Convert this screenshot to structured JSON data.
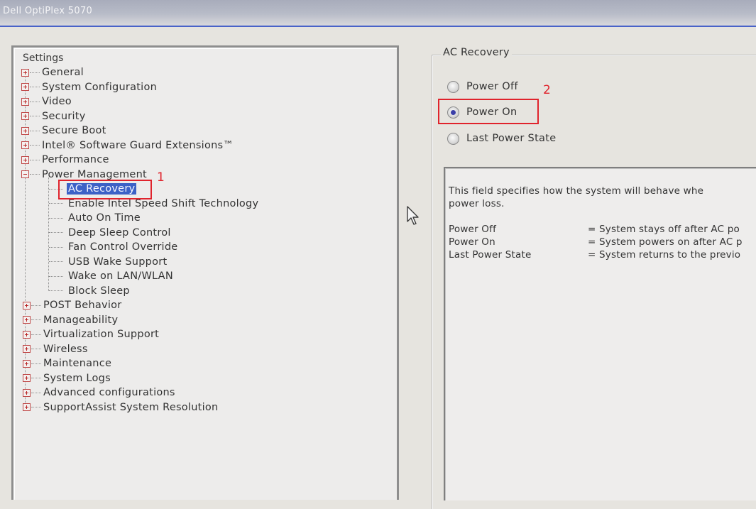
{
  "window": {
    "title": "Dell OptiPlex 5070"
  },
  "tree": {
    "root_label": "Settings",
    "categories_top": [
      {
        "label": "General",
        "expanded": false
      },
      {
        "label": "System Configuration",
        "expanded": false
      },
      {
        "label": "Video",
        "expanded": false
      },
      {
        "label": "Security",
        "expanded": false
      },
      {
        "label": "Secure Boot",
        "expanded": false
      },
      {
        "label": "Intel® Software Guard Extensions™",
        "expanded": false
      },
      {
        "label": "Performance",
        "expanded": false
      },
      {
        "label": "Power Management",
        "expanded": true
      }
    ],
    "power_management_children": [
      {
        "label": "AC Recovery",
        "selected": true
      },
      {
        "label": "Enable Intel Speed Shift Technology",
        "selected": false
      },
      {
        "label": "Auto On Time",
        "selected": false
      },
      {
        "label": "Deep Sleep Control",
        "selected": false
      },
      {
        "label": "Fan Control Override",
        "selected": false
      },
      {
        "label": "USB Wake Support",
        "selected": false
      },
      {
        "label": "Wake on LAN/WLAN",
        "selected": false
      },
      {
        "label": "Block Sleep",
        "selected": false
      }
    ],
    "categories_bottom": [
      {
        "label": "POST Behavior",
        "expanded": false
      },
      {
        "label": "Manageability",
        "expanded": false
      },
      {
        "label": "Virtualization Support",
        "expanded": false
      },
      {
        "label": "Wireless",
        "expanded": false
      },
      {
        "label": "Maintenance",
        "expanded": false
      },
      {
        "label": "System Logs",
        "expanded": false
      },
      {
        "label": "Advanced configurations",
        "expanded": false
      },
      {
        "label": "SupportAssist System Resolution",
        "expanded": false
      }
    ]
  },
  "ac_recovery": {
    "group_title": "AC Recovery",
    "options": [
      {
        "label": "Power Off",
        "checked": false
      },
      {
        "label": "Power On",
        "checked": true
      },
      {
        "label": "Last Power State",
        "checked": false
      }
    ],
    "description": {
      "line1": "This field specifies how the system will behave whe",
      "line2": "power loss.",
      "rows": [
        {
          "key": "Power Off",
          "value": "= System stays off after AC po"
        },
        {
          "key": "Power On",
          "value": "= System powers on after AC p"
        },
        {
          "key": "Last Power State",
          "value": "= System returns to the previo"
        }
      ]
    }
  },
  "annotations": {
    "one": "1",
    "two": "2",
    "color": "#e0232c"
  },
  "colors": {
    "selection": "#3c61c6",
    "title_accent": "#4a63c8"
  }
}
